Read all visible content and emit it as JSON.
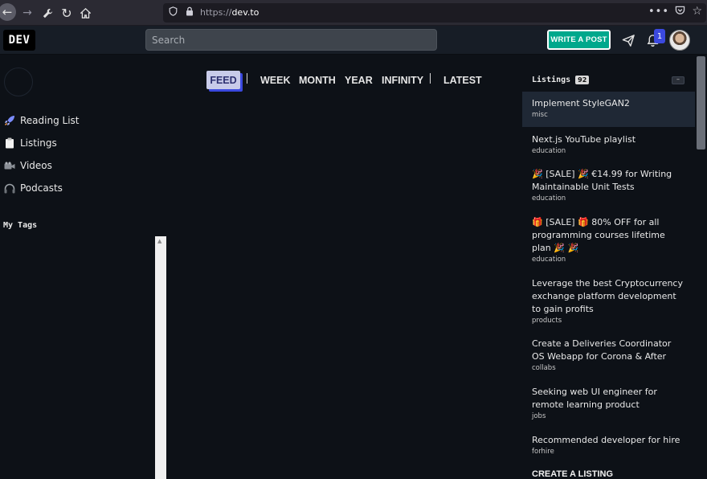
{
  "browser": {
    "url_prefix": "https://",
    "url_host": "dev.to",
    "more_label": "•••"
  },
  "header": {
    "logo": "DEV",
    "search_placeholder": "Search",
    "write_button": "WRITE A POST",
    "notification_count": "1"
  },
  "sidebar": {
    "items": [
      {
        "label": "Reading List",
        "icon": "rocket-icon"
      },
      {
        "label": "Listings",
        "icon": "clipboard-icon"
      },
      {
        "label": "Videos",
        "icon": "camera-icon"
      },
      {
        "label": "Podcasts",
        "icon": "headphones-icon"
      }
    ],
    "tags_title": "My Tags"
  },
  "feed": {
    "tabs": [
      "FEED",
      "WEEK",
      "MONTH",
      "YEAR",
      "INFINITY",
      "LATEST"
    ],
    "active_tab": "FEED"
  },
  "listings": {
    "title": "Listings",
    "count": "92",
    "collapse_label": "–",
    "items": [
      {
        "title": "Implement StyleGAN2",
        "category": "misc"
      },
      {
        "title": "Next.js YouTube playlist",
        "category": "education"
      },
      {
        "title": "🎉 [SALE] 🎉 €14.99 for Writing Maintainable Unit Tests",
        "category": "education"
      },
      {
        "title": "🎁 [SALE] 🎁 80% OFF for all programming courses lifetime plan 🎉 🎉",
        "category": "education"
      },
      {
        "title": "Leverage the best Cryptocurrency exchange platform development to gain profits",
        "category": "products"
      },
      {
        "title": "Create a Deliveries Coordinator OS Webapp for Corona & After",
        "category": "collabs"
      },
      {
        "title": "Seeking web UI engineer for remote learning product",
        "category": "jobs"
      },
      {
        "title": "Recommended developer for hire",
        "category": "forhire"
      }
    ],
    "create_label": "CREATE A LISTING"
  },
  "colors": {
    "background": "#0d1117",
    "header": "#171d26",
    "accent": "#3b49df",
    "write_button": "#00a88c"
  }
}
